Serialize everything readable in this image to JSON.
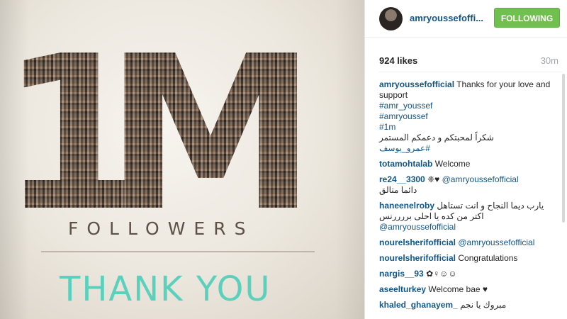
{
  "post_image": {
    "big_text_1": "1",
    "big_text_m": "M",
    "followers_label": "FOLLOWERS",
    "thank_you": "THANK YOU"
  },
  "header": {
    "username": "amryoussefoffi...",
    "follow_button": "FOLLOWING"
  },
  "stats": {
    "likes": "924 likes",
    "time": "30m"
  },
  "caption": {
    "user": "amryoussefofficial",
    "text": "Thanks for your love and support",
    "hashtags": [
      "#amr_youssef",
      "#amryoussef",
      "#1m"
    ],
    "arabic_line": "شكراً لمحبتكم و دعمكم المستمر",
    "arabic_tag": "#عمرو_يوسف"
  },
  "comments": [
    {
      "user": "totamohtalab",
      "text": "Welcome"
    },
    {
      "user": "re24__3300",
      "emoji": "❈♥",
      "mention": "@amryoussefofficial",
      "line2": "دائما متالق"
    },
    {
      "user": "haneenelroby",
      "text": "يارب ديما النجاح و انت تستاهل",
      "line2": "اكتر من كده يا احلى بررررنس",
      "mention": "@amryoussefofficial"
    },
    {
      "user": "nourelsherifofficial",
      "mention": "@amryoussefofficial"
    },
    {
      "user": "nourelsherifofficial",
      "text": "Congratulations"
    },
    {
      "user": "nargis__93",
      "text": "✿♀☺☺"
    },
    {
      "user": "aseelturkey",
      "text": "Welcome bae ♥"
    },
    {
      "user": "khaled_ghanayem_",
      "text": "مبروك يا نجم"
    }
  ],
  "colors": {
    "link": "#125688",
    "follow_button": "#70c050",
    "thank_you": "#5bd1bd"
  }
}
